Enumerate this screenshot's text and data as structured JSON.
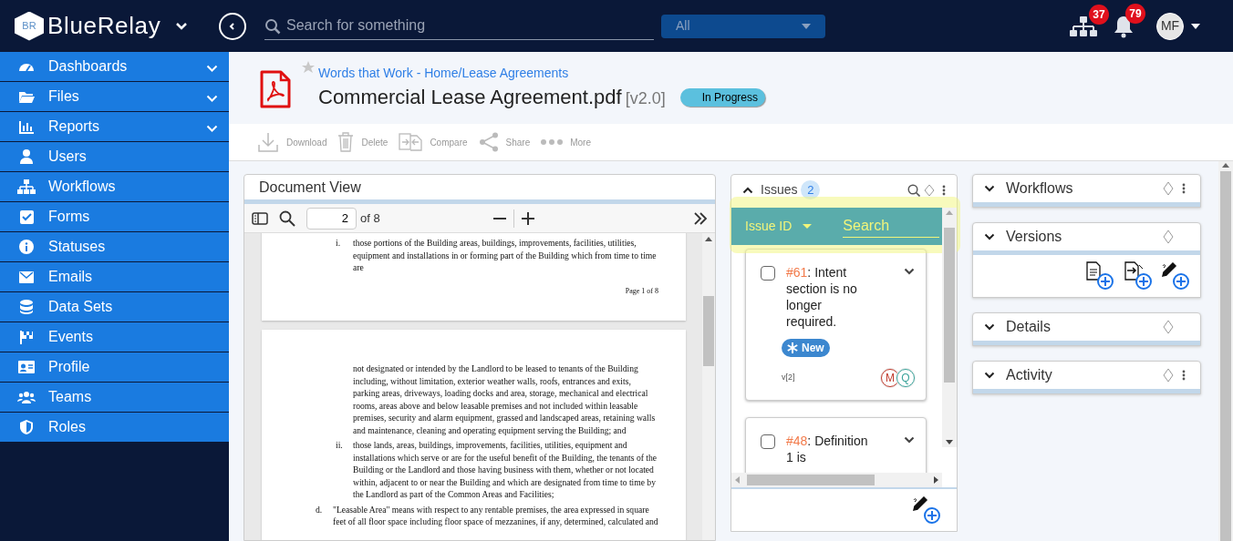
{
  "header": {
    "brand": "BlueRelay",
    "logo_letters": "BR",
    "search": {
      "placeholder": "Search for something"
    },
    "scope": "All",
    "badges": [
      "37",
      "79"
    ],
    "avatar": "MF"
  },
  "sidebar": {
    "items": [
      {
        "label": "Dashboards",
        "has_submenu": true
      },
      {
        "label": "Files",
        "has_submenu": true
      },
      {
        "label": "Reports",
        "has_submenu": true
      },
      {
        "label": "Users",
        "has_submenu": false
      },
      {
        "label": "Workflows",
        "has_submenu": false
      },
      {
        "label": "Forms",
        "has_submenu": false
      },
      {
        "label": "Statuses",
        "has_submenu": false
      },
      {
        "label": "Emails",
        "has_submenu": false
      },
      {
        "label": "Data Sets",
        "has_submenu": false
      },
      {
        "label": "Events",
        "has_submenu": false
      },
      {
        "label": "Profile",
        "has_submenu": false
      },
      {
        "label": "Teams",
        "has_submenu": false
      },
      {
        "label": "Roles",
        "has_submenu": false
      }
    ]
  },
  "document": {
    "breadcrumb": "Words that Work - Home/Lease Agreements",
    "title": "Commercial Lease Agreement.pdf",
    "version": "[v2.0]",
    "status": "In Progress",
    "starred": false
  },
  "toolbar": [
    "Download",
    "Delete",
    "Compare",
    "Share",
    "More"
  ],
  "document_view": {
    "title": "Document View",
    "page": "2",
    "page_count": "of 8",
    "pages": [
      {
        "items": [
          {
            "marker": "i.",
            "indent": true,
            "text": "those portions of the Building areas, buildings, improvements, facilities, utilities, equipment and installations in or forming part of the Building which from time to time are"
          }
        ],
        "footer": "Page 1 of 8"
      },
      {
        "items": [
          {
            "marker": "",
            "indent": true,
            "text": "not designated or intended by the Landlord to be leased to tenants of the Building including, without limitation, exterior weather walls, roofs, entrances and exits, parking areas, driveways, loading docks and area, storage, mechanical and electrical rooms, areas above and below leasable premises and not included within leasable premises, security and alarm equipment, grassed and landscaped areas, retaining walls and maintenance, cleaning and operating equipment serving the Building; and"
          },
          {
            "marker": "ii.",
            "indent": true,
            "text": "those lands, areas, buildings, improvements, facilities, utilities, equipment and installations which serve or are for the useful benefit of the Building, the tenants of the Building or the Landlord and those having business with them, whether or not located within, adjacent to or near the Building and which are designated from time to time by the Landlord as part of the Common Areas and Facilities;"
          },
          {
            "marker": "d.",
            "indent": false,
            "text": "\"Leasable Area\" means with respect to any rentable premises, the area expressed in square feet of all floor space including floor space of mezzanines, if any, determined, calculated and"
          }
        ]
      }
    ]
  },
  "issues": {
    "title": "Issues",
    "count": "2",
    "expanded": true,
    "filter": "Issue ID",
    "search_placeholder": "Search",
    "items": [
      {
        "id": "#61",
        "text": ": Intent section is no longer required.",
        "checked": false,
        "tag": "New",
        "version": "v[2]",
        "assignees": [
          {
            "initial": "M",
            "color": "#c0392b"
          },
          {
            "initial": "Q",
            "color": "#3aa39a"
          }
        ]
      },
      {
        "id": "#48",
        "text": ": Definition 1 is",
        "checked": false
      }
    ]
  },
  "panels": [
    {
      "title": "Workflows",
      "menu": true,
      "expanded": false
    },
    {
      "title": "Versions",
      "menu": false,
      "expanded": true
    },
    {
      "title": "Details",
      "menu": false,
      "expanded": false
    },
    {
      "title": "Activity",
      "menu": true,
      "expanded": false
    }
  ]
}
